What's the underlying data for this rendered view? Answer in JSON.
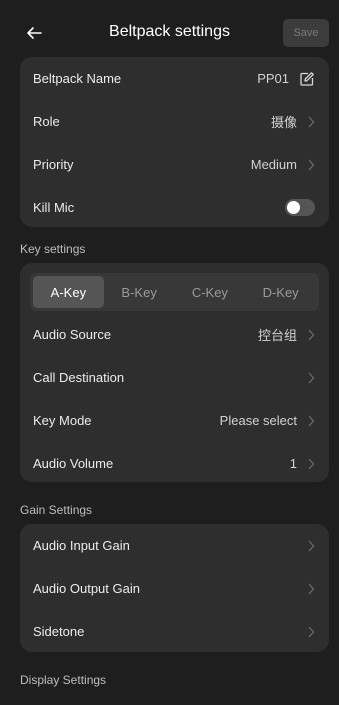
{
  "header": {
    "title": "Beltpack settings",
    "save_label": "Save"
  },
  "beltpack": {
    "name_label": "Beltpack Name",
    "name_value": "PP01",
    "role_label": "Role",
    "role_value": "摄像",
    "priority_label": "Priority",
    "priority_value": "Medium",
    "kill_mic_label": "Kill Mic",
    "kill_mic_on": false
  },
  "key_settings": {
    "title": "Key settings",
    "tabs": [
      {
        "label": "A-Key",
        "active": true
      },
      {
        "label": "B-Key",
        "active": false
      },
      {
        "label": "C-Key",
        "active": false
      },
      {
        "label": "D-Key",
        "active": false
      }
    ],
    "audio_source_label": "Audio Source",
    "audio_source_value": "控台组",
    "call_destination_label": "Call Destination",
    "call_destination_value": "",
    "key_mode_label": "Key Mode",
    "key_mode_value": "Please select",
    "audio_volume_label": "Audio Volume",
    "audio_volume_value": "1"
  },
  "gain_settings": {
    "title": "Gain Settings",
    "input_gain_label": "Audio Input Gain",
    "output_gain_label": "Audio Output Gain",
    "sidetone_label": "Sidetone"
  },
  "display_settings": {
    "title": "Display Settings"
  },
  "colors": {
    "background": "#1e1e1e",
    "card": "#2e2e2e",
    "active_tab": "#555555"
  },
  "icons": {
    "back": "arrow-left-icon",
    "edit": "edit-icon",
    "chevron": "chevron-right-icon"
  }
}
